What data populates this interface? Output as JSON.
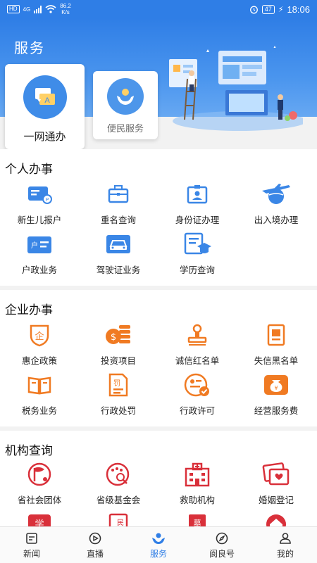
{
  "status_bar": {
    "hd": "HD",
    "network": "4G",
    "speed_value": "86.2",
    "speed_unit": "K/s",
    "battery": "47",
    "time": "18:06"
  },
  "header": {
    "title": "服务"
  },
  "quick_cards": [
    {
      "label": "一网通办",
      "icon": "chat-document-icon"
    },
    {
      "label": "便民服务",
      "icon": "caring-hands-icon"
    }
  ],
  "personal": {
    "title": "个人办事",
    "items": [
      {
        "label": "新生儿报户",
        "icon": "id-card-icon"
      },
      {
        "label": "重名查询",
        "icon": "briefcase-icon"
      },
      {
        "label": "身份证办理",
        "icon": "id-badge-icon"
      },
      {
        "label": "出入境办理",
        "icon": "airplane-globe-icon"
      },
      {
        "label": "户政业务",
        "icon": "household-card-icon"
      },
      {
        "label": "驾驶证业务",
        "icon": "car-icon"
      },
      {
        "label": "学历查询",
        "icon": "graduation-icon"
      }
    ]
  },
  "enterprise": {
    "title": "企业办事",
    "items": [
      {
        "label": "惠企政策",
        "icon": "enterprise-shield-icon"
      },
      {
        "label": "投资项目",
        "icon": "coin-stack-icon"
      },
      {
        "label": "诚信红名单",
        "icon": "stamp-icon"
      },
      {
        "label": "失信黑名单",
        "icon": "blacklist-icon"
      },
      {
        "label": "税务业务",
        "icon": "tax-book-icon"
      },
      {
        "label": "行政处罚",
        "icon": "penalty-document-icon"
      },
      {
        "label": "行政许可",
        "icon": "permit-icon"
      },
      {
        "label": "经营服务费",
        "icon": "money-bag-icon"
      }
    ]
  },
  "institution": {
    "title": "机构查询",
    "items": [
      {
        "label": "省社会团体",
        "icon": "flag-badge-icon"
      },
      {
        "label": "省级基金会",
        "icon": "foundation-search-icon"
      },
      {
        "label": "救助机构",
        "icon": "hospital-icon"
      },
      {
        "label": "婚姻登记",
        "icon": "marriage-certificate-icon"
      }
    ],
    "partial_items": [
      {
        "label": "学",
        "icon": "school-icon"
      },
      {
        "label": "民",
        "icon": "civil-icon"
      },
      {
        "label": "墓",
        "icon": "cemetery-icon"
      },
      {
        "label": "",
        "icon": "house-icon"
      }
    ]
  },
  "bottom_nav": [
    {
      "label": "新闻",
      "icon": "news-icon"
    },
    {
      "label": "直播",
      "icon": "live-icon"
    },
    {
      "label": "服务",
      "icon": "service-icon",
      "active": true
    },
    {
      "label": "阆良号",
      "icon": "compass-icon"
    },
    {
      "label": "我的",
      "icon": "user-icon"
    }
  ],
  "colors": {
    "primary": "#2f7ee6",
    "personal_icons": "#3a86e6",
    "enterprise_icons": "#f07a22",
    "institution_icons": "#d9303a"
  }
}
